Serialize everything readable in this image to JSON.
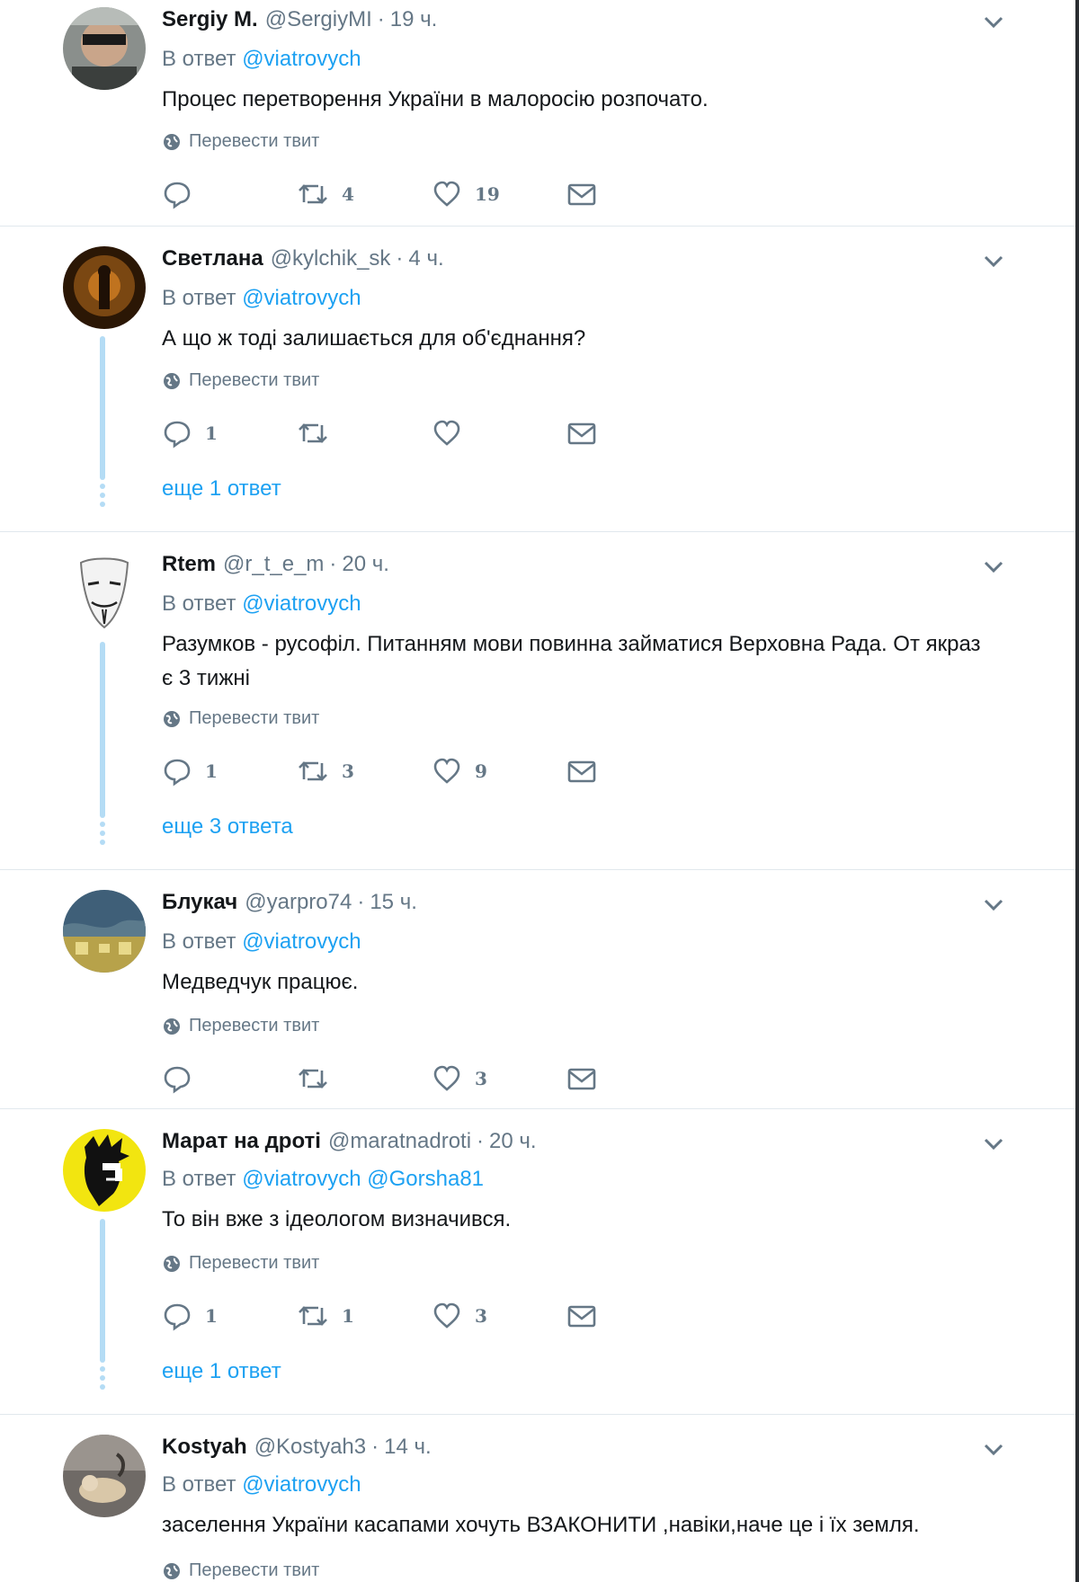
{
  "translate_label": "Перевести твит",
  "tweets": [
    {
      "name": "Sergiy M.",
      "handle": "@SergiyMI",
      "time": "19 ч.",
      "reply_prefix": "В ответ",
      "mentions": [
        "@viatrovych"
      ],
      "text": "Процес перетворення України в малоросію розпочато.",
      "replies": "",
      "retweets": "4",
      "likes": "19",
      "more": ""
    },
    {
      "name": "Светлана",
      "handle": "@kylchik_sk",
      "time": "4 ч.",
      "reply_prefix": "В ответ",
      "mentions": [
        "@viatrovych"
      ],
      "text": "А що ж тоді залишається для об'єднання?",
      "replies": "1",
      "retweets": "",
      "likes": "",
      "more": "еще 1 ответ"
    },
    {
      "name": "Rtem",
      "handle": "@r_t_e_m",
      "time": "20 ч.",
      "reply_prefix": "В ответ",
      "mentions": [
        "@viatrovych"
      ],
      "text": "Разумков - русофіл. Питанням мови повинна займатися Верховна Рада. От якраз є 3 тижні",
      "replies": "1",
      "retweets": "3",
      "likes": "9",
      "more": "еще 3 ответа"
    },
    {
      "name": "Блукач",
      "handle": "@yarpro74",
      "time": "15 ч.",
      "reply_prefix": "В ответ",
      "mentions": [
        "@viatrovych"
      ],
      "text": "Медведчук працює.",
      "replies": "",
      "retweets": "",
      "likes": "3",
      "more": ""
    },
    {
      "name": "Марат на дроті",
      "handle": "@maratnadroti",
      "time": "20 ч.",
      "reply_prefix": "В ответ",
      "mentions": [
        "@viatrovych",
        "@Gorsha81"
      ],
      "text": "То він вже з ідеологом визначився.",
      "replies": "1",
      "retweets": "1",
      "likes": "3",
      "more": "еще 1 ответ"
    },
    {
      "name": "Kostyah",
      "handle": "@Kostyah3",
      "time": "14 ч.",
      "reply_prefix": "В ответ",
      "mentions": [
        "@viatrovych"
      ],
      "text": "заселення України касапами хочуть ВЗАКОНИТИ ,навіки,наче це і їх земля.",
      "replies": "",
      "retweets": "",
      "likes": "",
      "more": ""
    }
  ],
  "colors": {
    "link": "#1da1f2",
    "muted": "#657786",
    "text": "#14171a",
    "thread_line": "#b4dcf5",
    "divider": "#e1e8ed"
  }
}
